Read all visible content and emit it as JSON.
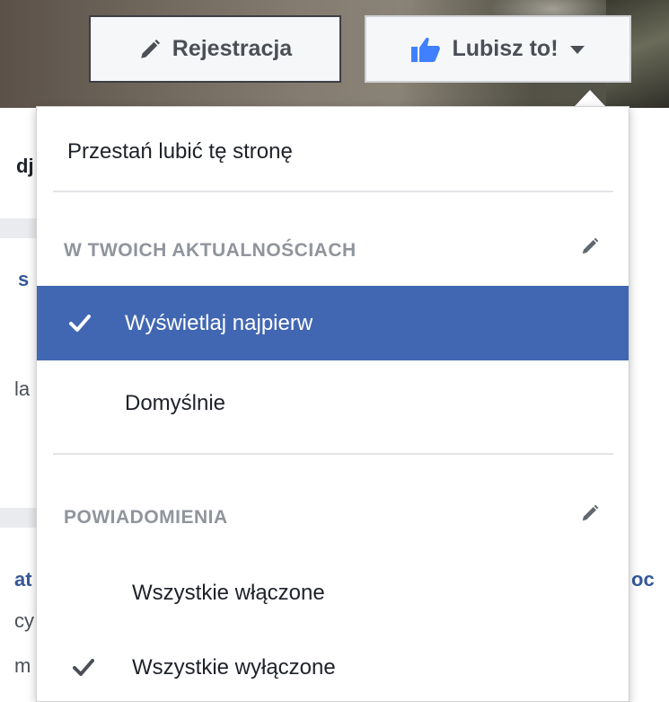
{
  "header": {
    "register_label": "Rejestracja",
    "like_label": "Lubisz to!"
  },
  "background": {
    "frag_1": "dj",
    "frag_2": "s",
    "frag_3": "la",
    "frag_4": "at",
    "frag_5": "cy",
    "frag_6": "m",
    "frag_7": "oc"
  },
  "menu": {
    "unlike_label": "Przestań lubić tę stronę",
    "feed_section": {
      "title": "W TWOICH AKTUALNOŚCIACH",
      "items": [
        {
          "label": "Wyświetlaj najpierw",
          "selected": true,
          "checked": true
        },
        {
          "label": "Domyślnie",
          "selected": false,
          "checked": false
        }
      ]
    },
    "notifications_section": {
      "title": "POWIADOMIENIA",
      "items": [
        {
          "label": "Wszystkie włączone",
          "checked": false
        },
        {
          "label": "Wszystkie wyłączone",
          "checked": true
        }
      ]
    }
  },
  "colors": {
    "accent": "#4267b2",
    "text": "#1d2129",
    "muted": "#90949c",
    "like_blue": "#4080ff"
  }
}
